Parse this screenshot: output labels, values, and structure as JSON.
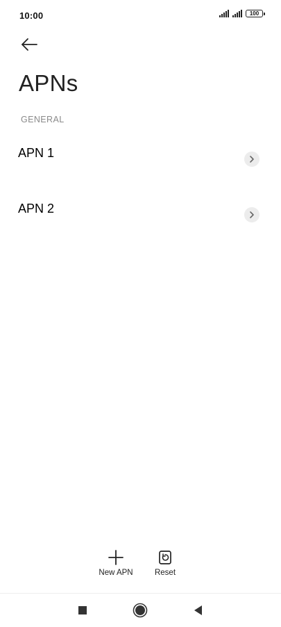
{
  "status_bar": {
    "time": "10:00",
    "battery": "100"
  },
  "header": {
    "title": "APNs"
  },
  "section": {
    "label": "GENERAL"
  },
  "apns": [
    {
      "name": "APN 1"
    },
    {
      "name": "APN 2"
    }
  ],
  "actions": {
    "new_apn_label": "New APN",
    "reset_label": "Reset"
  },
  "icons": {
    "back": "arrow-left-icon",
    "chevron": "chevron-right-icon",
    "new": "plus-icon",
    "reset": "reset-icon",
    "nav_recents": "square-icon",
    "nav_home": "circle-icon",
    "nav_back": "triangle-left-icon"
  },
  "colors": {
    "background": "#ffffff",
    "text": "#111111",
    "section": "#8a8a8a",
    "chevron_bg": "#ececec"
  }
}
